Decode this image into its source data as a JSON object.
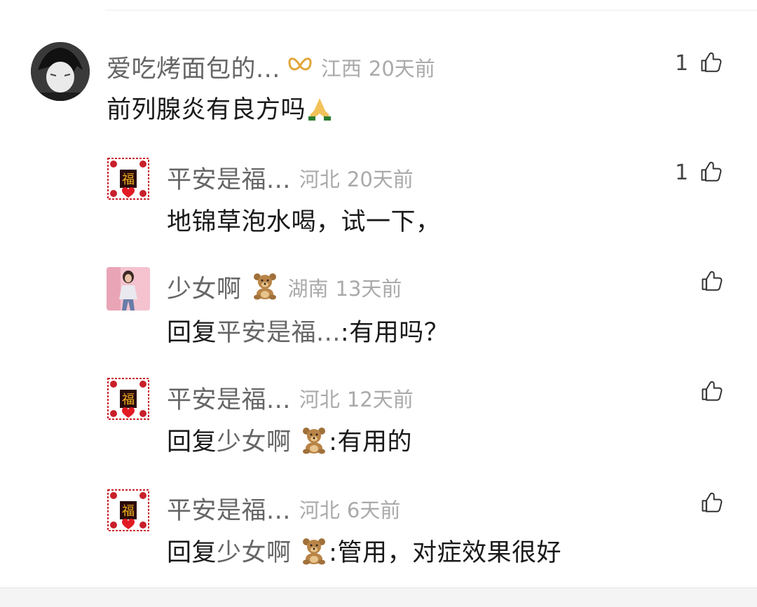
{
  "comments": [
    {
      "id": "c1",
      "name": "爱吃烤面包的...",
      "location": "江西",
      "time": "20天前",
      "text": "前列腺炎有良方吗",
      "text_emoji": "praying-hands",
      "likes": "1",
      "avatar": "dark-avatar"
    },
    {
      "id": "c2",
      "name": "平安是福...",
      "location": "河北",
      "time": "20天前",
      "text": "地锦草泡水喝，试一下，",
      "likes": "1",
      "avatar": "fu-avatar"
    },
    {
      "id": "c3",
      "name": "少女啊",
      "location": "湖南",
      "time": "13天前",
      "reply_prefix": "回复",
      "reply_target": "平安是福...",
      "text": ":有用吗？",
      "likes": "",
      "avatar": "girl-avatar"
    },
    {
      "id": "c4",
      "name": "平安是福...",
      "location": "河北",
      "time": "12天前",
      "reply_prefix": "回复",
      "reply_target": "少女啊",
      "text": ":有用的",
      "likes": "",
      "avatar": "fu-avatar"
    },
    {
      "id": "c5",
      "name": "平安是福...",
      "location": "河北",
      "time": "6天前",
      "reply_prefix": "回复",
      "reply_target": "少女啊",
      "text": ":管用，对症效果很好",
      "likes": "",
      "avatar": "fu-avatar"
    }
  ],
  "colors": {
    "name": "#666666",
    "meta": "#aaaaaa",
    "text": "#1a1a1a",
    "ribbon": "#e2a73a"
  }
}
